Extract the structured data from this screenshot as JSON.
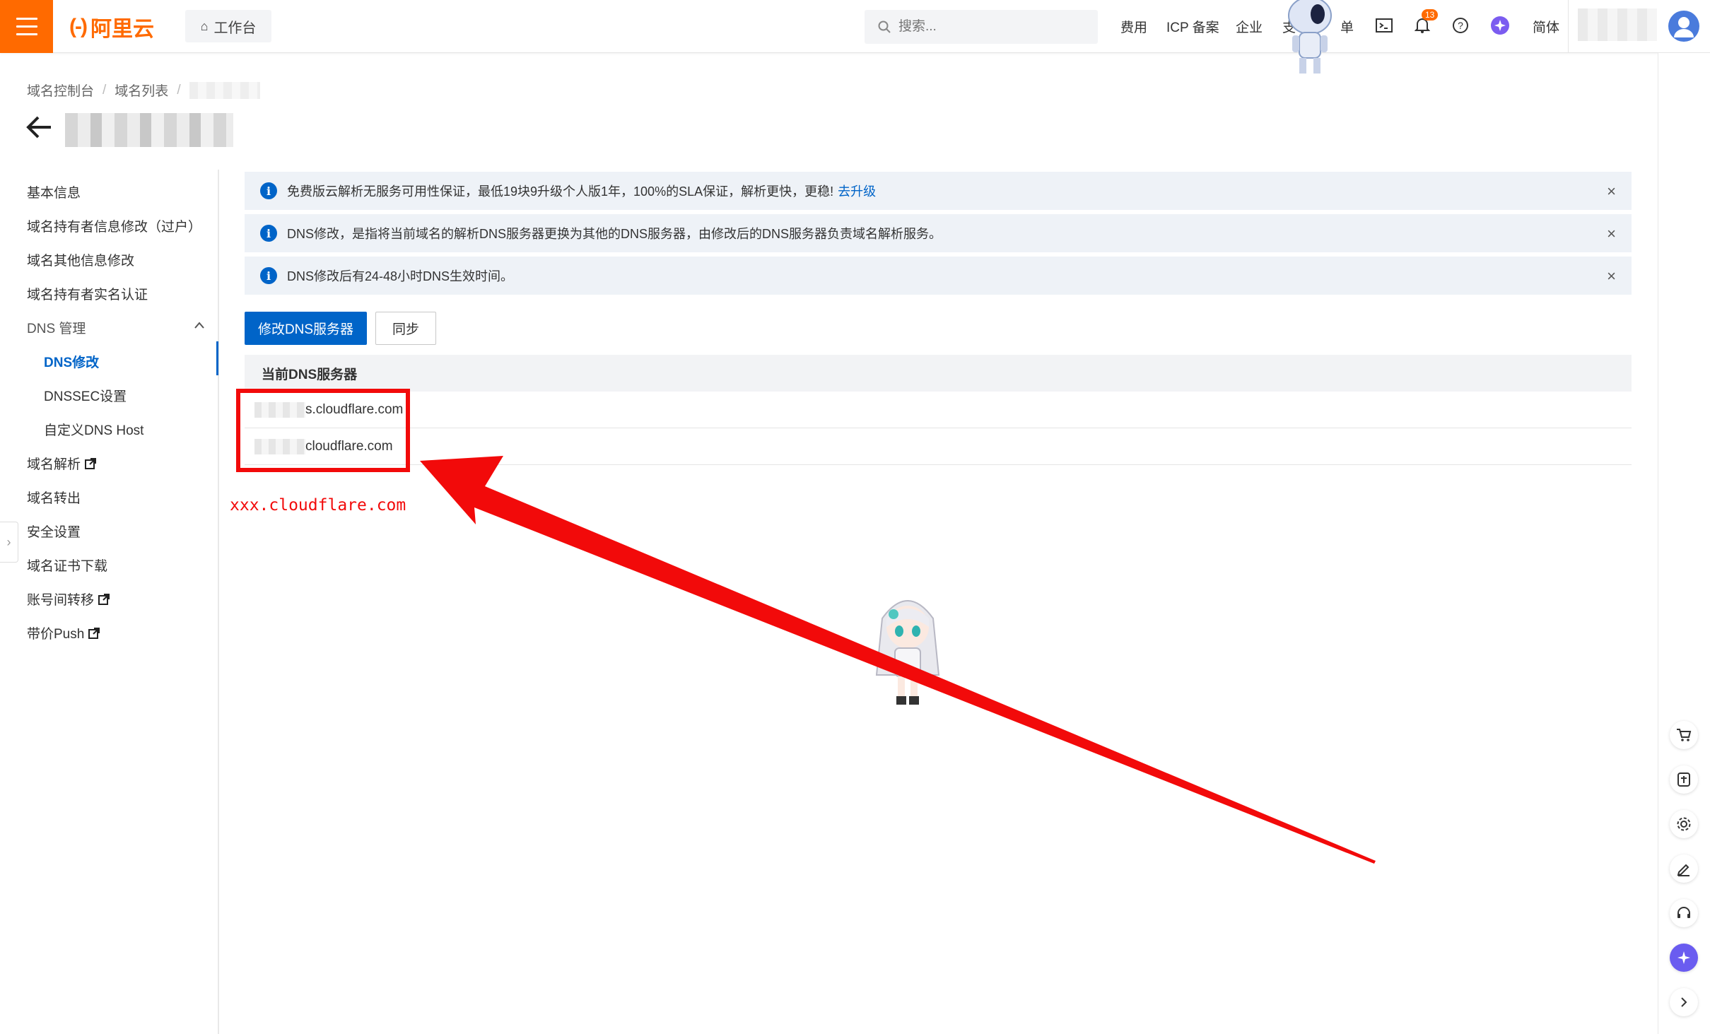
{
  "header": {
    "logo_text": "阿里云",
    "workbench_label": "工作台",
    "search_placeholder": "搜索...",
    "nav": [
      "费用",
      "ICP 备案",
      "企业",
      "支",
      "单"
    ],
    "notification_count": "13",
    "language_label": "简体"
  },
  "breadcrumb": {
    "items": [
      "域名控制台",
      "域名列表"
    ],
    "separator": "/"
  },
  "sidebar": {
    "items": [
      {
        "label": "基本信息"
      },
      {
        "label": "域名持有者信息修改（过户）"
      },
      {
        "label": "域名其他信息修改"
      },
      {
        "label": "域名持有者实名认证"
      },
      {
        "label": "DNS 管理"
      },
      {
        "label": "DNS修改"
      },
      {
        "label": "DNSSEC设置"
      },
      {
        "label": "自定义DNS Host"
      },
      {
        "label": "域名解析"
      },
      {
        "label": "域名转出"
      },
      {
        "label": "安全设置"
      },
      {
        "label": "域名证书下载"
      },
      {
        "label": "账号间转移"
      },
      {
        "label": "带价Push"
      }
    ],
    "active_item": "DNS修改"
  },
  "notices": [
    {
      "text": "免费版云解析无服务可用性保证，最低19块9升级个人版1年，100%的SLA保证，解析更快，更稳!",
      "link": "去升级"
    },
    {
      "text": "DNS修改，是指将当前域名的解析DNS服务器更换为其他的DNS服务器，由修改后的DNS服务器负责域名解析服务。"
    },
    {
      "text": "DNS修改后有24-48小时DNS生效时间。"
    }
  ],
  "close_symbol": "×",
  "info_symbol": "i",
  "actions": {
    "primary_label": "修改DNS服务器",
    "sync_label": "同步"
  },
  "dns_table": {
    "header": "当前DNS服务器",
    "rows": [
      "s.cloudflare.com",
      "cloudflare.com"
    ]
  },
  "annotation": {
    "note": "xxx.cloudflare.com",
    "color": "#f20a0a"
  },
  "colors": {
    "brand": "#ff6a00",
    "primary": "#0064c8"
  }
}
